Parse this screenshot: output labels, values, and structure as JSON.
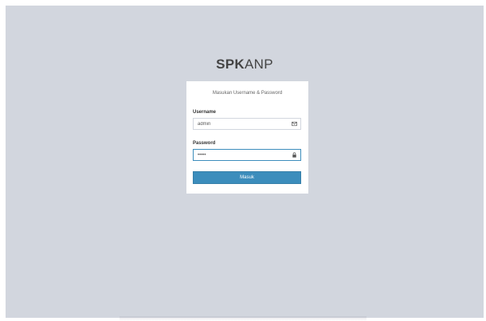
{
  "logo": {
    "bold": "SPK",
    "light": "ANP"
  },
  "login": {
    "message": "Masukan Username & Password",
    "username_label": "Username",
    "username_value": "admin",
    "password_label": "Password",
    "password_value": "•••••",
    "submit_label": "Masuk"
  },
  "icons": {
    "username": "envelope-icon",
    "password": "lock-icon"
  },
  "colors": {
    "background": "#d2d6de",
    "box": "#ffffff",
    "accent": "#3c8dbc",
    "text": "#444444"
  }
}
